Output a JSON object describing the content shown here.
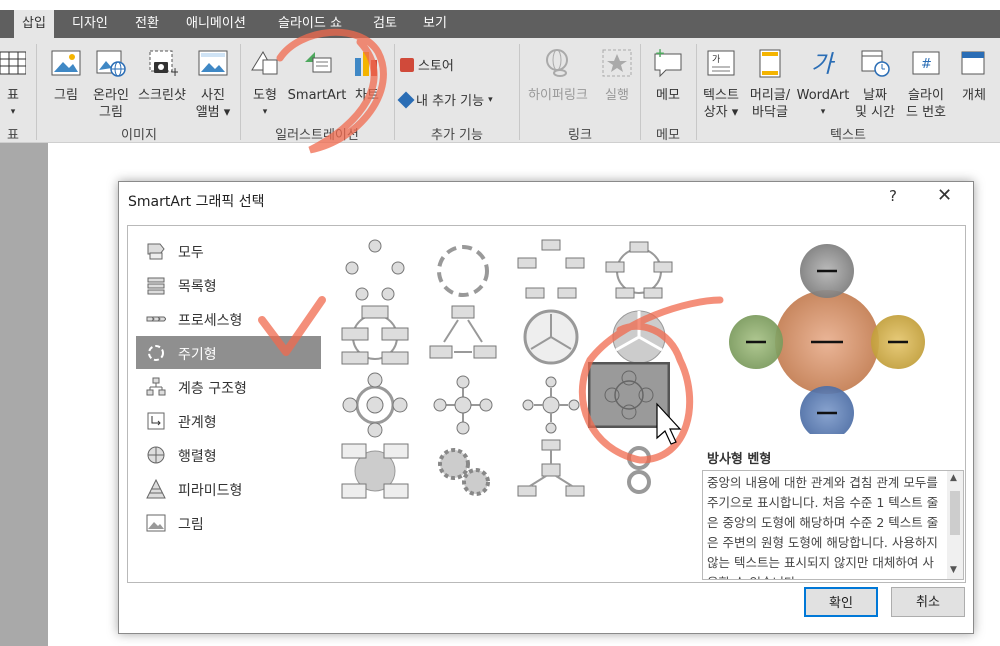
{
  "ribbon": {
    "tabs": [
      "삽입",
      "디자인",
      "전환",
      "애니메이션",
      "슬라이드 쇼",
      "검토",
      "보기"
    ],
    "buttons": {
      "table": "표",
      "picture": "그림",
      "online_picture_1": "온라인",
      "online_picture_2": "그림",
      "screenshot": "스크린샷",
      "photo_album_1": "사진",
      "photo_album_2": "앨범",
      "shapes": "도형",
      "smartart": "SmartArt",
      "chart": "차트",
      "store": "스토어",
      "my_addins": "내 추가 기능",
      "hyperlink": "하이퍼링크",
      "action": "실행",
      "comment": "메모",
      "textbox_1": "텍스트",
      "textbox_2": "상자",
      "header_footer_1": "머리글/",
      "header_footer_2": "바닥글",
      "wordart": "WordArt",
      "datetime_1": "날짜",
      "datetime_2": "및 시간",
      "slide_number_1": "슬라이",
      "slide_number_2": "드 번호",
      "object": "개체"
    },
    "groups": {
      "table": "표",
      "images": "이미지",
      "illustrations": "일러스트레이션",
      "addins": "추가 기능",
      "links": "링크",
      "comments": "메모",
      "text": "텍스트"
    }
  },
  "dialog": {
    "title": "SmartArt 그래픽 선택",
    "help": "?",
    "close": "✕",
    "categories": [
      "모두",
      "목록형",
      "프로세스형",
      "주기형",
      "계층 구조형",
      "관계형",
      "행렬형",
      "피라미드형",
      "그림"
    ],
    "selected_category": "주기형",
    "preview_title": "방사형 벤형",
    "preview_description": "중앙의 내용에 대한 관계와 겹침 관계 모두를 주기으로 표시합니다. 처음 수준 1 텍스트 줄은 중앙의 도형에 해당하며 수준 2 텍스트 줄은 주변의 원형 도형에 해당합니다. 사용하지 않는 텍스트는 표시되지 않지만 대체하여 사용할 수 있습니다.",
    "ok": "확인",
    "cancel": "취소",
    "colors": {
      "center": "#d99a76",
      "top": "#8c8c8c",
      "left": "#8ba96b",
      "right": "#d6b04a",
      "bottom": "#5c7fb5",
      "annotation": "#f06a4e"
    }
  }
}
